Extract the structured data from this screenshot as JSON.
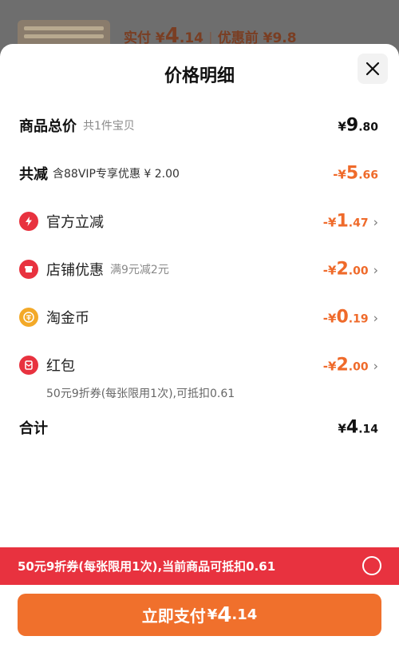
{
  "background": {
    "price_prefix": "实付",
    "price_currency": "¥",
    "price_int": "4",
    "price_dec": ".14",
    "separator": "|",
    "before_text": "优惠前 ¥9.8"
  },
  "sheet": {
    "title": "价格明细"
  },
  "rows": {
    "total": {
      "label": "商品总价",
      "sub": "共1件宝贝",
      "currency": "¥",
      "int": "9",
      "dec": ".80"
    },
    "reduction": {
      "label": "共减",
      "sub": "含88VIP专享优惠 ¥ 2.00",
      "prefix": "-¥",
      "int": "5",
      "dec": ".66"
    },
    "official": {
      "label": "官方立减",
      "prefix": "-¥",
      "int": "1",
      "dec": ".47"
    },
    "store": {
      "label": "店铺优惠",
      "sub": "满9元减2元",
      "prefix": "-¥",
      "int": "2",
      "dec": ".00"
    },
    "coins": {
      "label": "淘金币",
      "prefix": "-¥",
      "int": "0",
      "dec": ".19"
    },
    "redpacket": {
      "label": "红包",
      "note": "50元9折券(每张限用1次),可抵扣0.61",
      "prefix": "-¥",
      "int": "2",
      "dec": ".00"
    },
    "sum": {
      "label": "合计",
      "currency": "¥",
      "int": "4",
      "dec": ".14"
    }
  },
  "banner": {
    "text": "50元9折券(每张限用1次),当前商品可抵扣0.61"
  },
  "pay_button": {
    "label": "立即支付",
    "currency": "¥",
    "int": "4",
    "dec": ".14"
  },
  "colors": {
    "accent_orange": "#f0702c",
    "discount_orange": "#ef6a2a",
    "banner_red": "#e8323f"
  }
}
